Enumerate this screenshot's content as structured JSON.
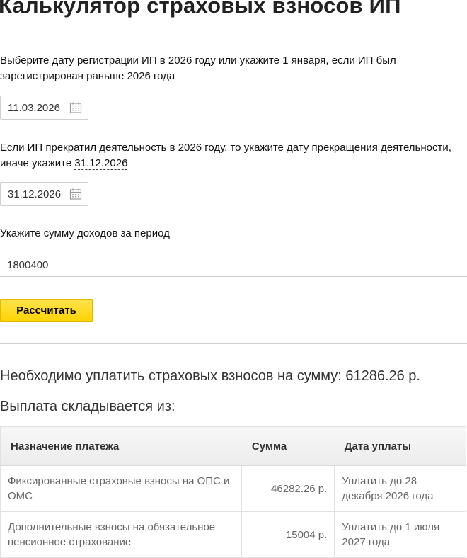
{
  "page": {
    "title": "Калькулятор страховых взносов ИП"
  },
  "registration": {
    "label": "Выберите дату регистрации ИП в 2026 году или укажите 1 января, если ИП был зарегистрирован раньше 2026 года",
    "date_value": "11.03.2026"
  },
  "termination": {
    "label_prefix": "Если ИП прекратил деятельность в 2026 году, то укажите дату прекращения деятельности, иначе укажите ",
    "label_link": "31.12.2026",
    "date_value": "31.12.2026"
  },
  "income": {
    "label": "Укажите сумму доходов за период",
    "value": "1800400"
  },
  "calculate_button": {
    "label": "Рассчитать"
  },
  "result": {
    "total_text": "Необходимо уплатить страховых взносов на сумму: 61286.26 р.",
    "breakdown_heading": "Выплата складывается из:"
  },
  "table": {
    "headers": [
      "Назначение платежа",
      "Сумма",
      "Дата уплаты"
    ],
    "rows": [
      {
        "purpose": "Фиксированные страховые взносы на ОПС и ОМС",
        "amount": "46282.26 р.",
        "due": "Уплатить до 28 декабря 2026 года"
      },
      {
        "purpose": "Дополнительные взносы на обязательное пенсионное страхование",
        "amount": "15004 р.",
        "due": "Уплатить до 1 июля 2027 года"
      }
    ]
  },
  "icons": {
    "date_picker": "calendar-icon"
  },
  "colors": {
    "button_yellow": "#ffd400",
    "border": "#cfcfcf"
  }
}
